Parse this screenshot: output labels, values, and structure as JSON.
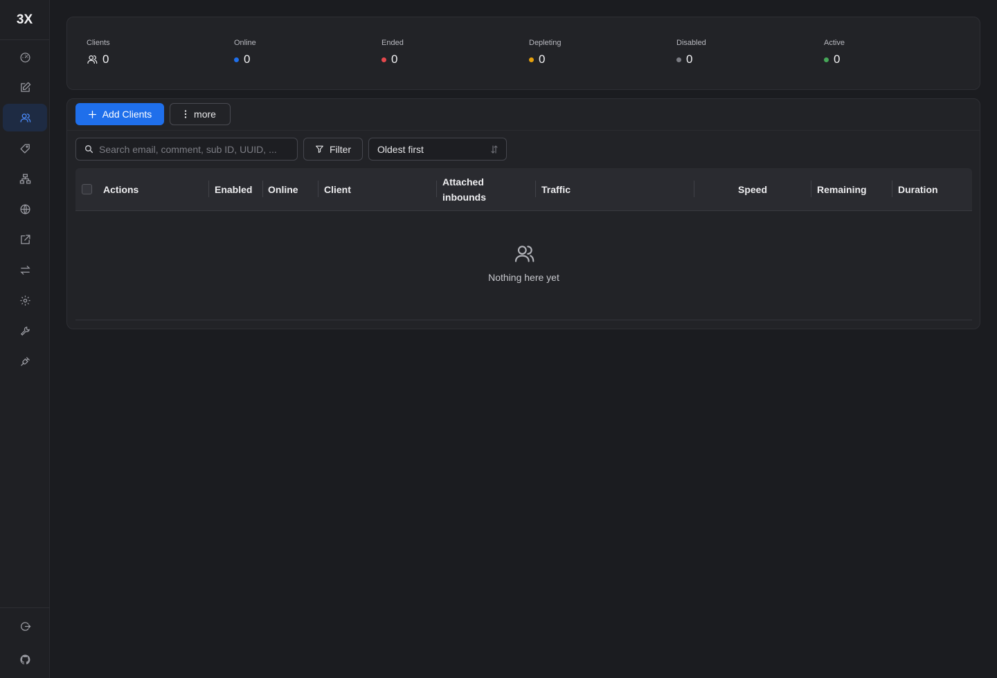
{
  "app": {
    "logo": "3X"
  },
  "sidebar": {
    "items": [
      {
        "icon": "dashboard-icon",
        "active": false
      },
      {
        "icon": "edit-icon",
        "active": false
      },
      {
        "icon": "users-icon",
        "active": true
      },
      {
        "icon": "tag-icon",
        "active": false
      },
      {
        "icon": "network-icon",
        "active": false
      },
      {
        "icon": "globe-icon",
        "active": false
      },
      {
        "icon": "external-link-icon",
        "active": false
      },
      {
        "icon": "swap-icon",
        "active": false
      },
      {
        "icon": "gear-icon",
        "active": false
      },
      {
        "icon": "wrench-icon",
        "active": false
      },
      {
        "icon": "plug-icon",
        "active": false
      }
    ],
    "bottom": [
      {
        "icon": "logout-icon"
      },
      {
        "icon": "github-icon"
      }
    ]
  },
  "stats": [
    {
      "label": "Clients",
      "value": "0",
      "indicator": "users-icon"
    },
    {
      "label": "Online",
      "value": "0",
      "color": "#1f6feb"
    },
    {
      "label": "Ended",
      "value": "0",
      "color": "#e5484d"
    },
    {
      "label": "Depleting",
      "value": "0",
      "color": "#e5a00d"
    },
    {
      "label": "Disabled",
      "value": "0",
      "color": "#7a7b82"
    },
    {
      "label": "Active",
      "value": "0",
      "color": "#46a758"
    }
  ],
  "toolbar": {
    "add_label": "Add Clients",
    "more_label": "more"
  },
  "search": {
    "placeholder": "Search email, comment, sub ID, UUID, ..."
  },
  "filter": {
    "label": "Filter"
  },
  "sort": {
    "selected": "Oldest first"
  },
  "table": {
    "columns": {
      "actions": "Actions",
      "enabled": "Enabled",
      "online": "Online",
      "client": "Client",
      "attached_1": "Attached",
      "attached_2": "inbounds",
      "traffic": "Traffic",
      "speed": "Speed",
      "remaining": "Remaining",
      "duration": "Duration"
    },
    "empty_text": "Nothing here yet"
  },
  "colors": {
    "accent": "#1f6feb",
    "active_nav_bg": "#1e2b43"
  }
}
